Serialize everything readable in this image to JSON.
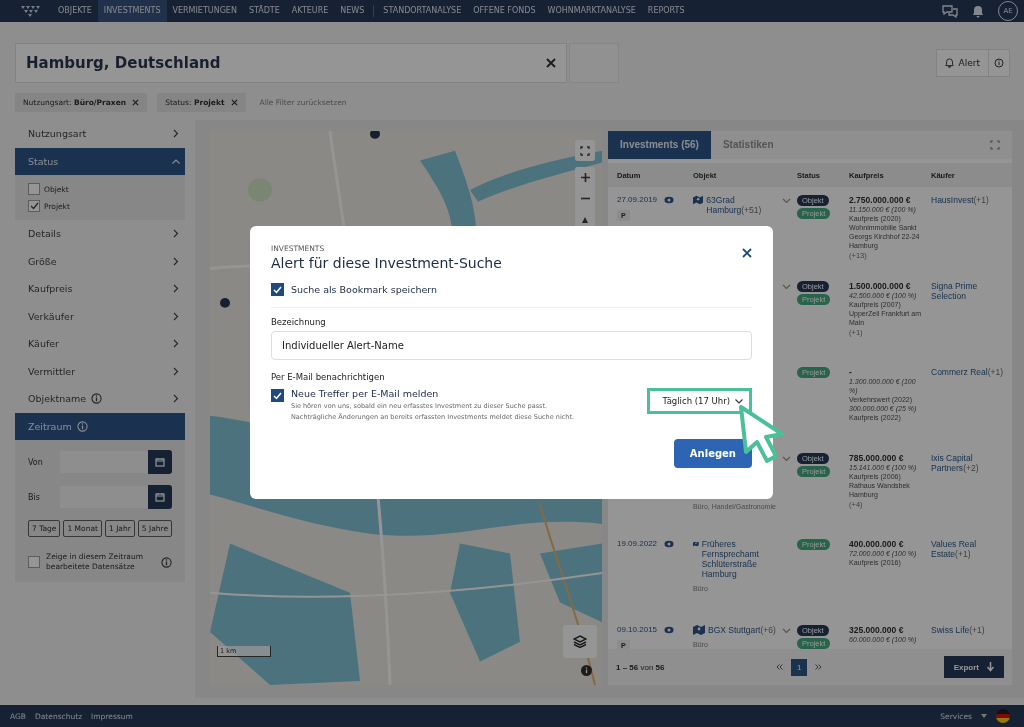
{
  "nav": {
    "items": [
      {
        "label": "OBJEKTE",
        "selected": false
      },
      {
        "label": "INVESTMENTS",
        "selected": true
      },
      {
        "label": "VERMIETUNGEN",
        "selected": false
      },
      {
        "label": "STÄDTE",
        "selected": false
      },
      {
        "label": "AKTEURE",
        "selected": false
      },
      {
        "label": "NEWS",
        "selected": false
      },
      {
        "label": "STANDORTANALYSE",
        "selected": false
      },
      {
        "label": "OFFENE FONDS",
        "selected": false
      },
      {
        "label": "WOHNMARKTANALYSE",
        "selected": false
      },
      {
        "label": "REPORTS",
        "selected": false
      }
    ],
    "avatar": "AE"
  },
  "search": {
    "value": "Hamburg, Deutschland"
  },
  "alert_button": "Alert",
  "filters": {
    "chips": [
      "Nutzungsart: **Büro/Praxen**",
      "Status: **Projekt**"
    ],
    "reset": "Alle Filter zurücksetzen"
  },
  "sidebar": {
    "items": [
      {
        "label": "Nutzungsart",
        "expanded": false,
        "info": false
      },
      {
        "label": "Status",
        "expanded": true,
        "info": false,
        "options": [
          {
            "label": "Objekt",
            "checked": false
          },
          {
            "label": "Projekt",
            "checked": true
          }
        ]
      },
      {
        "label": "Details",
        "expanded": false,
        "info": false
      },
      {
        "label": "Größe",
        "expanded": false,
        "info": false
      },
      {
        "label": "Kaufpreis",
        "expanded": false,
        "info": false
      },
      {
        "label": "Verkäufer",
        "expanded": false,
        "info": false
      },
      {
        "label": "Käufer",
        "expanded": false,
        "info": false
      },
      {
        "label": "Vermittler",
        "expanded": false,
        "info": false
      },
      {
        "label": "Objektname",
        "expanded": false,
        "info": true
      }
    ],
    "period": {
      "label": "Zeitraum",
      "from_label": "Von",
      "to_label": "Bis",
      "ranges": [
        "7 Tage",
        "1 Monat",
        "1 Jahr",
        "5 Jahre"
      ],
      "edited": {
        "label": "Zeige in diesem Zeitraum bearbeitete Datensätze",
        "checked": false
      }
    }
  },
  "map": {
    "scale": "1 km"
  },
  "results": {
    "tabs": [
      {
        "label": "Investments (56)",
        "selected": true
      },
      {
        "label": "Statistiken",
        "selected": false
      }
    ],
    "columns": [
      "Datum",
      "Objekt",
      "Status",
      "Kaufpreis",
      "Käufer"
    ],
    "rows": [
      {
        "date": "27.09.2019",
        "badge": "P",
        "object": "63Grad Hamburg",
        "object_count": "(+51)",
        "expandable": true,
        "statuses": [
          {
            "label": "Objekt",
            "kind": "objekt"
          },
          {
            "label": "Projekt",
            "kind": "projekt"
          }
        ],
        "price": "2.750.000.000 €",
        "details": [
          {
            "text": "11.150.000 € (100 %)",
            "kind": "share"
          },
          {
            "text": "Kaufpreis (2020)",
            "kind": "note"
          },
          {
            "text": "Wohnimmobilie Sankt Georgs Kirchhof 22-24 Hamburg",
            "kind": "note"
          },
          {
            "text": "(+13)",
            "kind": "count"
          }
        ],
        "buyer": "HausInvest",
        "buyer_count": "(+1)"
      },
      {
        "expandable": true,
        "statuses": [
          {
            "label": "Objekt",
            "kind": "objekt"
          },
          {
            "label": "Projekt",
            "kind": "projekt"
          }
        ],
        "price": "1.500.000.000 €",
        "details": [
          {
            "text": "42.500.000 € (100 %)",
            "kind": "share"
          },
          {
            "text": "Kaufpreis (2007)",
            "kind": "note"
          },
          {
            "text": "UpperZeil Frankfurt am Main",
            "kind": "note"
          },
          {
            "text": "(+1)",
            "kind": "count"
          }
        ],
        "buyer": "Signa Prime Selection"
      },
      {
        "expandable": false,
        "statuses": [
          {
            "label": "Projekt",
            "kind": "projekt"
          }
        ],
        "price": "-",
        "details": [
          {
            "text": "1.300.000.000 € (100 %)",
            "kind": "share"
          },
          {
            "text": "Verkehrswert (2022)",
            "kind": "note"
          },
          {
            "text": "300.000.000 € (25 %)",
            "kind": "share"
          },
          {
            "text": "Kaufpreis (2022)",
            "kind": "note"
          }
        ],
        "buyer": "Commerz Real",
        "buyer_count": "(+1)"
      },
      {
        "use": "Büro, Handel/Gastronomie",
        "expandable": true,
        "statuses": [
          {
            "label": "Objekt",
            "kind": "objekt"
          },
          {
            "label": "Projekt",
            "kind": "projekt"
          }
        ],
        "price": "785.000.000 €",
        "details": [
          {
            "text": "15.141.000 € (100 %)",
            "kind": "share"
          },
          {
            "text": "Kaufpreis (2006)",
            "kind": "note"
          },
          {
            "text": "Rathaus Wandsbek Hamburg",
            "kind": "note"
          },
          {
            "text": "(+4)",
            "kind": "count"
          }
        ],
        "buyer": "Ixis Capital Partners",
        "buyer_count": "(+2)"
      },
      {
        "date": "19.09.2022",
        "object": "Früheres Fernsprechamt Schlüterstraße Hamburg",
        "use": "Büro",
        "expandable": false,
        "statuses": [
          {
            "label": "Projekt",
            "kind": "projekt"
          }
        ],
        "price": "400.000.000 €",
        "details": [
          {
            "text": "72.000.000 € (100 %)",
            "kind": "share"
          },
          {
            "text": "Kaufpreis (2016)",
            "kind": "note"
          }
        ],
        "buyer": "Values Real Estate",
        "buyer_count": "(+1)"
      },
      {
        "date": "09.10.2015",
        "badge": "P",
        "object": "BGX Stuttgart",
        "object_count": "(+6)",
        "use": "Büro",
        "expandable": true,
        "statuses": [
          {
            "label": "Objekt",
            "kind": "objekt"
          },
          {
            "label": "Projekt",
            "kind": "projekt"
          }
        ],
        "price": "325.000.000 €",
        "details": [
          {
            "text": "60.000.000 € (100 %)",
            "kind": "share"
          }
        ],
        "buyer": "Swiss Life",
        "buyer_count": "(+1)"
      }
    ],
    "range": "**1 – 56** von **56**",
    "pages": [
      {
        "label": "1",
        "selected": true
      }
    ],
    "export": "Export"
  },
  "footer": {
    "links": [
      "AGB",
      "Datenschutz",
      "Impressum"
    ],
    "services": "Services"
  },
  "modal": {
    "eyebrow": "INVESTMENTS",
    "title": "Alert für diese Investment-Suche",
    "bookmark": {
      "label": "Suche als Bookmark speichern",
      "checked": true
    },
    "name_label": "Bezeichnung",
    "name_value": "Individueller Alert-Name",
    "email_label": "Per E-Mail benachrichtigen",
    "notify": {
      "label": "Neue Treffer per E-Mail melden",
      "checked": true,
      "hint_lines": [
        "Sie hören von uns, sobald ein neu erfasstes Investment zu dieser Suche passt.",
        "Nachträgliche Änderungen an bereits erfassten Investments meldet diese Suche nicht."
      ]
    },
    "frequency": {
      "value": "Täglich (17 Uhr)",
      "highlighted": true
    },
    "submit": "Anlegen"
  }
}
